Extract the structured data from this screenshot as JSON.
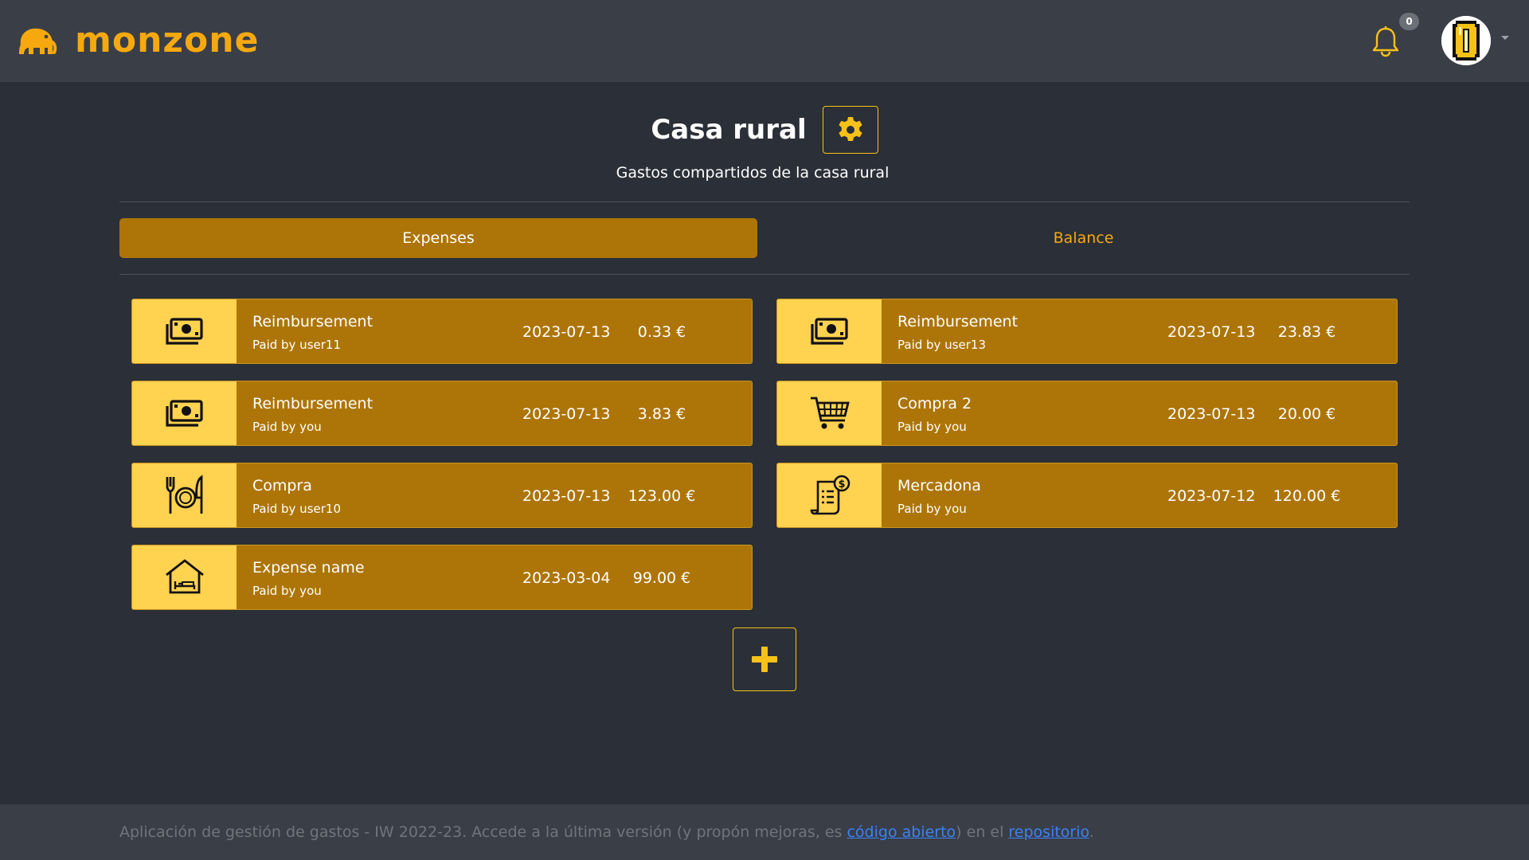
{
  "header": {
    "brand": "monzone",
    "notifications_count": "0",
    "colors": {
      "brand": "#f6a90f",
      "bar": "#3a3e47"
    }
  },
  "group": {
    "title": "Casa rural",
    "description": "Gastos compartidos de la casa rural"
  },
  "tabs": [
    {
      "label": "Expenses",
      "active": true
    },
    {
      "label": "Balance",
      "active": false
    }
  ],
  "expenses": [
    {
      "name": "Reimbursement",
      "paid_by": "Paid by user11",
      "date": "2023-07-13",
      "amount": "0.33 €",
      "icon": "money-icon"
    },
    {
      "name": "Reimbursement",
      "paid_by": "Paid by user13",
      "date": "2023-07-13",
      "amount": "23.83 €",
      "icon": "money-icon"
    },
    {
      "name": "Reimbursement",
      "paid_by": "Paid by you",
      "date": "2023-07-13",
      "amount": "3.83 €",
      "icon": "money-icon"
    },
    {
      "name": "Compra 2",
      "paid_by": "Paid by you",
      "date": "2023-07-13",
      "amount": "20.00 €",
      "icon": "shopping-cart-icon"
    },
    {
      "name": "Compra",
      "paid_by": "Paid by user10",
      "date": "2023-07-13",
      "amount": "123.00 €",
      "icon": "restaurant-icon"
    },
    {
      "name": "Mercadona",
      "paid_by": "Paid by you",
      "date": "2023-07-12",
      "amount": "120.00 €",
      "icon": "invoice-icon"
    },
    {
      "name": "Expense name",
      "paid_by": "Paid by you",
      "date": "2023-03-04",
      "amount": "99.00 €",
      "icon": "house-icon"
    }
  ],
  "footer": {
    "text_before": "Aplicación de gestión de gastos - IW 2022-23. Accede a la última versión (y propón mejoras, es ",
    "link_open_source": "código abierto",
    "text_middle": ") en el ",
    "link_repo": "repositorio",
    "text_after": "."
  }
}
